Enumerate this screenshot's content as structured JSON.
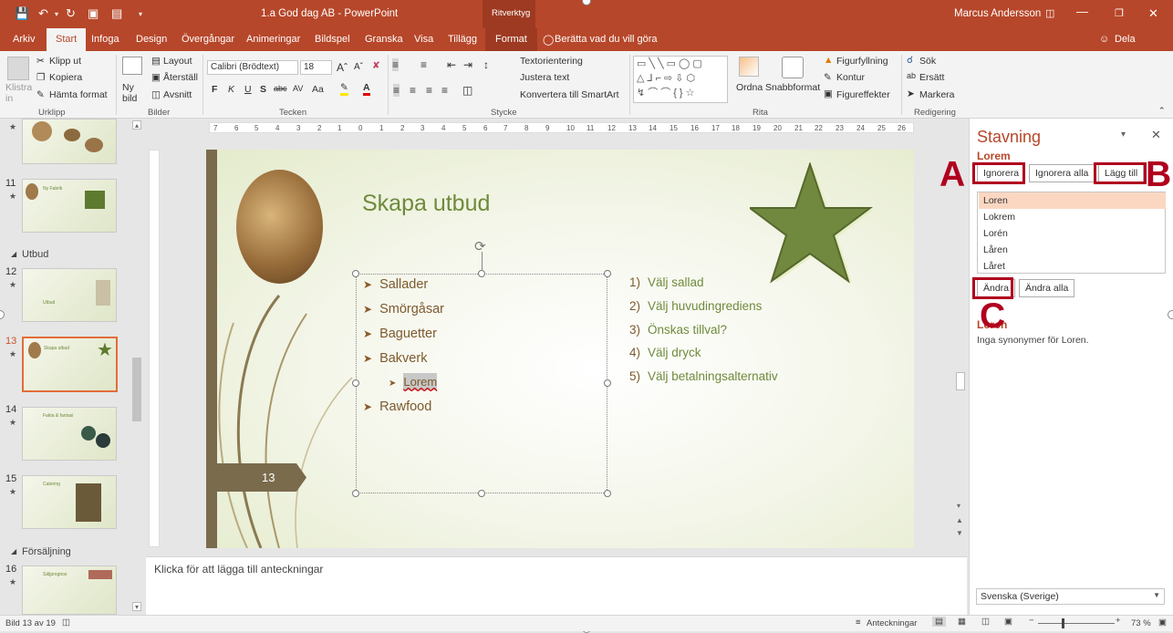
{
  "titlebar": {
    "document_title": "1.a God dag AB - PowerPoint",
    "context_tab": "Ritverktyg",
    "user": "Marcus Andersson"
  },
  "tabs": [
    "Arkiv",
    "Start",
    "Infoga",
    "Design",
    "Övergångar",
    "Animeringar",
    "Bildspel",
    "Granska",
    "Visa",
    "Tillägg",
    "Format"
  ],
  "tell_me": "Berätta vad du vill göra",
  "share": "Dela",
  "ribbon": {
    "urklipp": {
      "paste": "Klistra in",
      "cut": "Klipp ut",
      "copy": "Kopiera",
      "format_painter": "Hämta format",
      "group": "Urklipp"
    },
    "bilder": {
      "new_slide": "Ny bild",
      "layout": "Layout",
      "reset": "Återställ",
      "section": "Avsnitt",
      "group": "Bilder"
    },
    "tecken": {
      "font": "Calibri (Brödtext)",
      "size": "18",
      "bold": "F",
      "italic": "K",
      "underline": "U",
      "shadow": "S",
      "strike": "abc",
      "spacing": "AV",
      "case": "Aa",
      "group": "Tecken"
    },
    "stycke": {
      "text_direction": "Textorientering",
      "align_text": "Justera text",
      "smartart": "Konvertera till SmartArt",
      "group": "Stycke"
    },
    "rita": {
      "arrange": "Ordna",
      "quick_styles": "Snabbformat",
      "fill": "Figurfyllning",
      "outline": "Kontur",
      "effects": "Figureffekter",
      "group": "Rita"
    },
    "redigering": {
      "find": "Sök",
      "replace": "Ersätt",
      "select": "Markera",
      "group": "Redigering"
    }
  },
  "thumbs": {
    "sections": [
      "Utbud",
      "Försäljning"
    ],
    "slides": [
      {
        "num": "",
        "title": ""
      },
      {
        "num": "11",
        "title": "Ny Fabrik"
      },
      {
        "num": "12",
        "title": "Utbud"
      },
      {
        "num": "13",
        "title": "Skapa utbud"
      },
      {
        "num": "14",
        "title": "Fakta & fantasi"
      },
      {
        "num": "15",
        "title": "Catering"
      },
      {
        "num": "16",
        "title": "Säljprognos"
      }
    ]
  },
  "slide": {
    "title": "Skapa utbud",
    "bullets": [
      "Sallader",
      "Smörgåsar",
      "Baguetter",
      "Bakverk",
      "Lorem",
      "Rawfood"
    ],
    "numbered": [
      {
        "n": "1)",
        "t": "Välj sallad"
      },
      {
        "n": "2)",
        "t": "Välj huvudingrediens"
      },
      {
        "n": "3)",
        "t": "Önskas tillval?"
      },
      {
        "n": "4)",
        "t": "Välj dryck"
      },
      {
        "n": "5)",
        "t": "Välj betalningsalternativ"
      }
    ],
    "page_number": "13"
  },
  "ruler_ticks": [
    "7",
    "6",
    "5",
    "4",
    "3",
    "2",
    "1",
    "0",
    "1",
    "2",
    "3",
    "4",
    "5",
    "6",
    "7",
    "8",
    "9",
    "10",
    "11",
    "12",
    "13",
    "14",
    "15",
    "16",
    "17",
    "18",
    "19",
    "20",
    "21",
    "22",
    "23",
    "24",
    "25",
    "26"
  ],
  "notes_placeholder": "Klicka för att lägga till anteckningar",
  "spelling_pane": {
    "title": "Stavning",
    "word": "Lorem",
    "ignore": "Ignorera",
    "ignore_all": "Ignorera alla",
    "add": "Lägg till",
    "suggestions": [
      "Loren",
      "Lokrem",
      "Lorén",
      "Låren",
      "Låret"
    ],
    "change": "Ändra",
    "change_all": "Ändra alla",
    "synonym_word": "Loren",
    "no_synonyms": "Inga synonymer för Loren.",
    "language": "Svenska (Sverige)"
  },
  "annotations": {
    "a": "A",
    "b": "B",
    "c": "C"
  },
  "status": {
    "slide_info": "Bild 13 av 19",
    "notes": "Anteckningar",
    "zoom": "73 %"
  },
  "colors": {
    "brand": "#b7472a",
    "title_green": "#6f8a3c",
    "body_brown": "#7d5a2e",
    "annotation_red": "#b0001e"
  }
}
